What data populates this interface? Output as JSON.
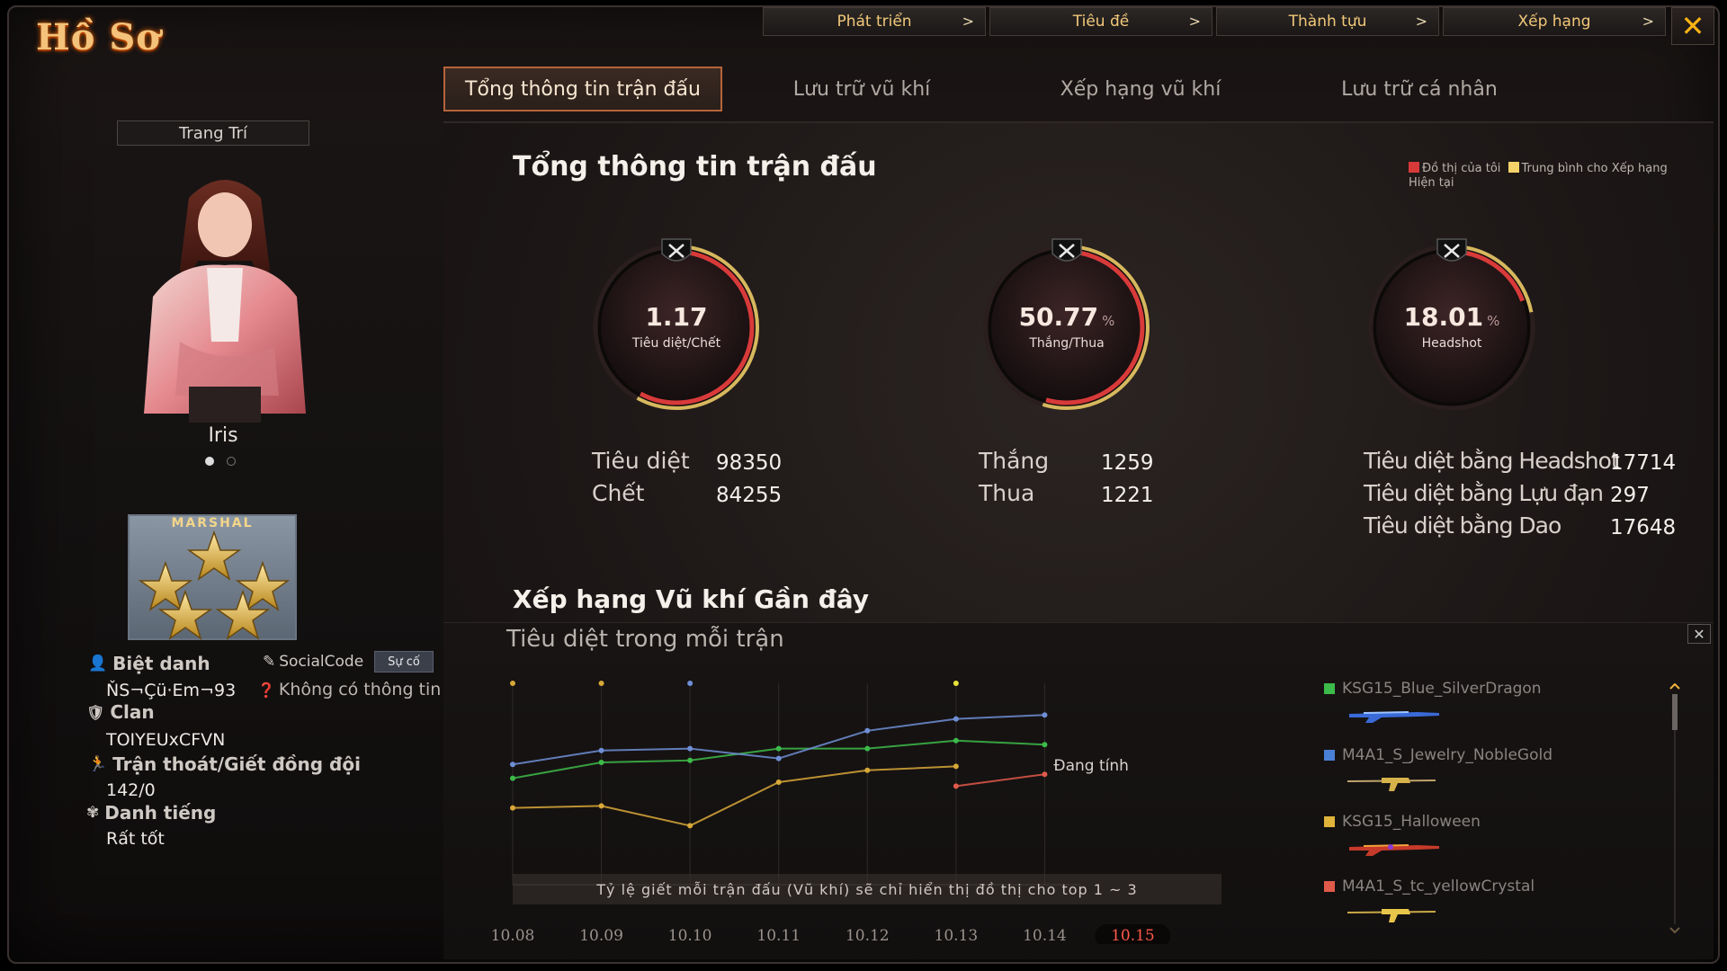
{
  "window": {
    "title": "Hồ Sơ",
    "close_icon": "✕"
  },
  "top_menu": [
    {
      "label": "Phát triển",
      "arrow": ">"
    },
    {
      "label": "Tiêu đề",
      "arrow": ">"
    },
    {
      "label": "Thành tựu",
      "arrow": ">"
    },
    {
      "label": "Xếp hạng",
      "arrow": ">"
    }
  ],
  "tabs": [
    {
      "label": "Tổng thông tin trận đấu",
      "active": true
    },
    {
      "label": "Lưu trữ vũ khí",
      "active": false
    },
    {
      "label": "Xếp hạng vũ khí",
      "active": false
    },
    {
      "label": "Lưu trữ cá nhân",
      "active": false
    }
  ],
  "profile": {
    "decor_label": "Trang Trí",
    "character_name": "Iris",
    "rank_title": "MARSHAL",
    "nickname_label": "Biệt danh",
    "nickname": "ŇS¬Çü·Em¬93",
    "socialcode_label": "SocialCode",
    "report_button": "Sự cố",
    "no_info": "Không có thông tin",
    "clan_label": "Clan",
    "clan": "TOIYEUxCFVN",
    "escape_label": "Trận thoát/Giết đồng đội",
    "escape_value": "142/0",
    "reputation_label": "Danh tiếng",
    "reputation_value": "Rất tốt"
  },
  "summary": {
    "title": "Tổng thông tin trận đấu",
    "legend": {
      "mine": "Đồ thị của tôi",
      "avg": "Trung bình cho Xếp hạng Hiện tại",
      "mine_color": "#d83a3a",
      "avg_color": "#f5d36a"
    },
    "gauges": [
      {
        "value": "1.17",
        "unit": "",
        "caption": "Tiêu diệt/Chết",
        "fraction": 0.54,
        "icon": "skull-crossed-guns-icon"
      },
      {
        "value": "50.77",
        "unit": "%",
        "caption": "Thắng/Thua",
        "fraction": 0.5077,
        "icon": "crossed-guns-icon"
      },
      {
        "value": "18.01",
        "unit": "%",
        "caption": "Headshot",
        "fraction": 0.1801,
        "icon": "headshot-crosshair-icon"
      }
    ],
    "stats": {
      "kill_label": "Tiêu diệt",
      "kill": "98350",
      "death_label": "Chết",
      "death": "84255",
      "win_label": "Thắng",
      "win": "1259",
      "lose_label": "Thua",
      "lose": "1221",
      "hs_label": "Tiêu diệt bằng Headshot",
      "hs": "17714",
      "grenade_label": "Tiêu diệt bằng Lựu đạn",
      "grenade": "297",
      "knife_label": "Tiêu diệt bằng Dao",
      "knife": "17648"
    }
  },
  "weapon_ranking": {
    "title": "Xếp hạng Vũ khí Gần đây",
    "subtitle": "Tiêu diệt trong mỗi trận",
    "pending_label": "Đang tính",
    "note": "Tỷ lệ giết mỗi trận đấu (Vũ khí) sẽ chỉ hiển thị đồ thị cho top 1 ~ 3",
    "weapons": [
      {
        "name": "KSG15_Blue_SilverDragon",
        "color": "#3dbb4a"
      },
      {
        "name": "M4A1_S_Jewelry_NobleGold",
        "color": "#4a7fd6"
      },
      {
        "name": "KSG15_Halloween",
        "color": "#e0b43a"
      },
      {
        "name": "M4A1_S_tc_yellowCrystal",
        "color": "#e05a4a"
      }
    ]
  },
  "chart_data": {
    "type": "line",
    "title": "",
    "xlabel": "",
    "ylabel": "",
    "categories": [
      "10.08",
      "10.09",
      "10.10",
      "10.11",
      "10.12",
      "10.13",
      "10.14",
      "10.15"
    ],
    "selected_category": "10.15",
    "series": [
      {
        "name": "KSG15_Blue_SilverDragon",
        "color": "#3dbb4a",
        "values": [
          0.52,
          0.6,
          0.61,
          0.67,
          0.67,
          0.71,
          0.69,
          null
        ]
      },
      {
        "name": "M4A1_S_Jewelry_NobleGold",
        "color": "#6e8fd6",
        "values": [
          0.59,
          0.66,
          0.67,
          0.62,
          0.76,
          0.82,
          0.84,
          null
        ]
      },
      {
        "name": "KSG15_Halloween",
        "color": "#d8a838",
        "values": [
          0.37,
          0.38,
          0.28,
          0.5,
          0.56,
          0.58,
          null,
          null
        ]
      },
      {
        "name": "M4A1_S_tc_yellowCrystal",
        "color": "#e05a4a",
        "values": [
          null,
          null,
          null,
          null,
          null,
          0.48,
          0.54,
          null
        ]
      }
    ],
    "markers": [
      {
        "x": "10.08",
        "color": "#d8a838"
      },
      {
        "x": "10.09",
        "color": "#d8a838"
      },
      {
        "x": "10.10",
        "color": "#6e8fd6"
      },
      {
        "x": "10.13",
        "color": "#e6e33a"
      }
    ],
    "ylim": [
      0,
      1
    ]
  }
}
